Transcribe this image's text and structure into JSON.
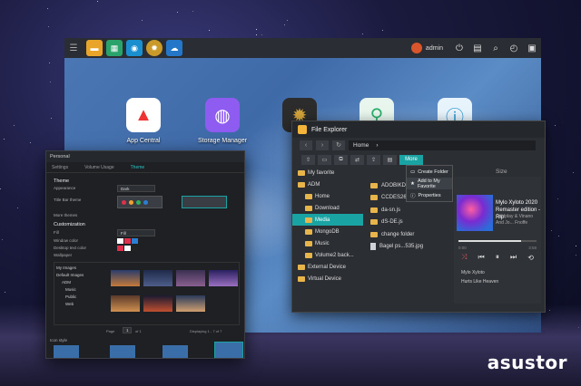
{
  "brand": "asustor",
  "taskbar": {
    "user": "admin"
  },
  "desktop_apps": [
    {
      "label": "App Central",
      "icon": "app-central-icon",
      "color": "#ffffff"
    },
    {
      "label": "Storage Manager",
      "icon": "storage-manager-icon",
      "color": "#8e5cf0"
    }
  ],
  "file_explorer": {
    "title": "File Explorer",
    "path": "Home",
    "more_label": "More",
    "size_header": "Size",
    "tree": [
      {
        "label": "My favorite",
        "active": false
      },
      {
        "label": "ADM",
        "active": false
      },
      {
        "label": "Home",
        "active": false
      },
      {
        "label": "Download",
        "active": false
      },
      {
        "label": "Media",
        "active": true
      },
      {
        "label": "MongoDB",
        "active": false
      },
      {
        "label": "Music",
        "active": false
      },
      {
        "label": "Volume2 back...",
        "active": false
      },
      {
        "label": "External Device",
        "active": false
      },
      {
        "label": "Virtual Device",
        "active": false
      }
    ],
    "files": [
      {
        "name": "ADOBIKD10...",
        "type": "folder"
      },
      {
        "name": "CCDES2656...",
        "type": "folder"
      },
      {
        "name": "da-sn.js",
        "type": "folder"
      },
      {
        "name": "dS-DE.js",
        "type": "folder"
      },
      {
        "name": "change folder",
        "type": "folder"
      },
      {
        "name": "Bagel ps...535.jpg",
        "type": "file"
      }
    ],
    "context_menu": [
      "Create Folder",
      "Add to My Favorite",
      "Properties"
    ]
  },
  "music": {
    "title": "Mylo Xyloto 2020 Remaster edition - Rip",
    "artist": "Coldplay & Vinano And Jo... Fnoffe",
    "progress": 0.8,
    "time_left": "0:00",
    "time_right": "3:58",
    "playlist": [
      "Mylo Xyloto",
      "Hurts Like Heaven"
    ]
  },
  "personal": {
    "title": "Personal",
    "tabs": [
      "Settings",
      "Volume Usage",
      "Theme"
    ],
    "active_tab": "Theme",
    "theme_label": "Theme",
    "appearance_label": "Appearance",
    "appearance_value": "Dark",
    "title_bar_theme_label": "Title Bar theme",
    "more_themes_label": "More themes",
    "customization_label": "Customization",
    "fill_label": "Fill",
    "fill_value": "Fill",
    "window_color_label": "Window color",
    "desktop_text_label": "Desktop text color",
    "wallpaper_label": "Wallpaper",
    "image_tree": [
      "My Images",
      "Default Images",
      "ADM",
      "Music",
      "Public",
      "Web"
    ],
    "page_label": "Page",
    "page_value": "1",
    "page_of": "of 1",
    "paging": "Displaying 1 - 7 of 7",
    "icon_style_label": "Icon style",
    "swatches": [
      "#ffffff",
      "#e0304b",
      "#2a7fd4",
      "#e0304b",
      "#ffffff",
      "#222222"
    ]
  }
}
